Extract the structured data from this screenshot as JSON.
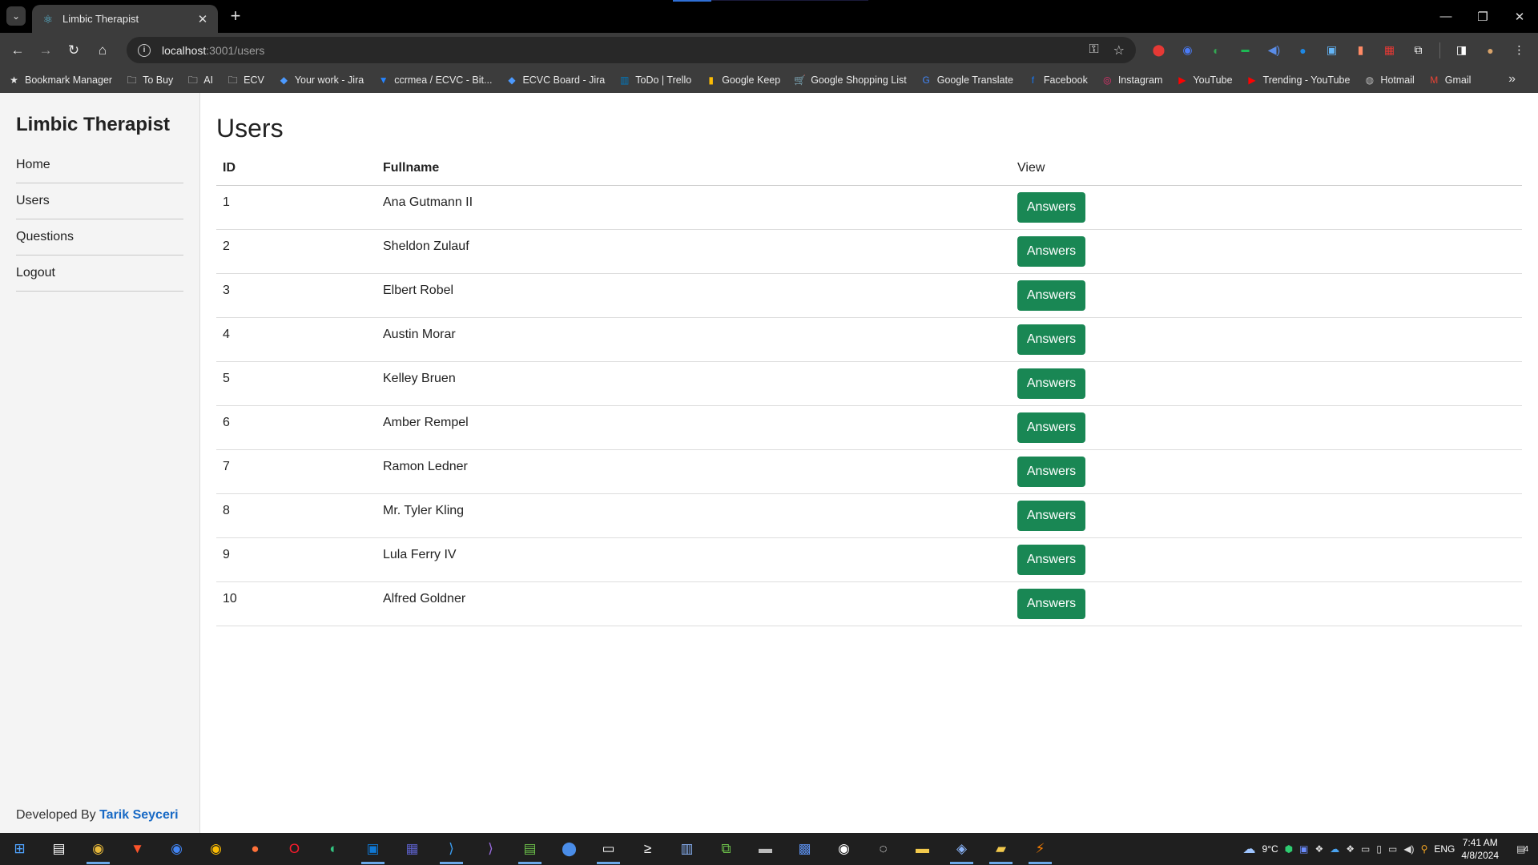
{
  "browser": {
    "tab_title": "Limbic Therapist",
    "url_host": "localhost",
    "url_path": ":3001/users",
    "bookmarks": [
      {
        "label": "Bookmark Manager",
        "icon": "star-icon",
        "color": "#e8e8e8"
      },
      {
        "label": "To Buy",
        "icon": "folder-icon",
        "color": "#e8e8e8"
      },
      {
        "label": "AI",
        "icon": "folder-icon",
        "color": "#e8e8e8"
      },
      {
        "label": "ECV",
        "icon": "folder-icon",
        "color": "#e8e8e8"
      },
      {
        "label": "Your work - Jira",
        "icon": "jira-icon",
        "color": "#4c9aff"
      },
      {
        "label": "ccrmea / ECVC - Bit...",
        "icon": "bitbucket-icon",
        "color": "#2684ff"
      },
      {
        "label": "ECVC Board - Jira",
        "icon": "jira-icon",
        "color": "#4c9aff"
      },
      {
        "label": "ToDo | Trello",
        "icon": "trello-icon",
        "color": "#0079bf"
      },
      {
        "label": "Google Keep",
        "icon": "keep-icon",
        "color": "#fbbc04"
      },
      {
        "label": "Google Shopping List",
        "icon": "cart-icon",
        "color": "#4285f4"
      },
      {
        "label": "Google Translate",
        "icon": "translate-icon",
        "color": "#4285f4"
      },
      {
        "label": "Facebook",
        "icon": "facebook-icon",
        "color": "#1877f2"
      },
      {
        "label": "Instagram",
        "icon": "instagram-icon",
        "color": "#e1306c"
      },
      {
        "label": "YouTube",
        "icon": "youtube-icon",
        "color": "#ff0000"
      },
      {
        "label": "Trending - YouTube",
        "icon": "youtube-icon",
        "color": "#ff0000"
      },
      {
        "label": "Hotmail",
        "icon": "hotmail-icon",
        "color": "#bbbbbb"
      },
      {
        "label": "Gmail",
        "icon": "gmail-icon",
        "color": "#ea4335"
      }
    ]
  },
  "sidebar": {
    "brand": "Limbic Therapist",
    "items": [
      {
        "label": "Home"
      },
      {
        "label": "Users"
      },
      {
        "label": "Questions"
      },
      {
        "label": "Logout"
      }
    ],
    "footer_prefix": "Developed By",
    "footer_author": "Tarik Seyceri"
  },
  "main": {
    "title": "Users",
    "columns": {
      "id": "ID",
      "name": "Fullname",
      "view": "View"
    },
    "action_label": "Answers",
    "rows": [
      {
        "id": "1",
        "name": "Ana Gutmann II"
      },
      {
        "id": "2",
        "name": "Sheldon Zulauf"
      },
      {
        "id": "3",
        "name": "Elbert Robel"
      },
      {
        "id": "4",
        "name": "Austin Morar"
      },
      {
        "id": "5",
        "name": "Kelley Bruen"
      },
      {
        "id": "6",
        "name": "Amber Rempel"
      },
      {
        "id": "7",
        "name": "Ramon Ledner"
      },
      {
        "id": "8",
        "name": "Mr. Tyler Kling"
      },
      {
        "id": "9",
        "name": "Lula Ferry IV"
      },
      {
        "id": "10",
        "name": "Alfred Goldner"
      }
    ]
  },
  "taskbar": {
    "weather": "9°C",
    "language": "ENG",
    "time": "7:41 AM",
    "date": "4/8/2024",
    "notifications": "4"
  },
  "colors": {
    "primary_button": "#198754",
    "link": "#1769c5",
    "sidebar_bg": "#f4f4f4"
  }
}
